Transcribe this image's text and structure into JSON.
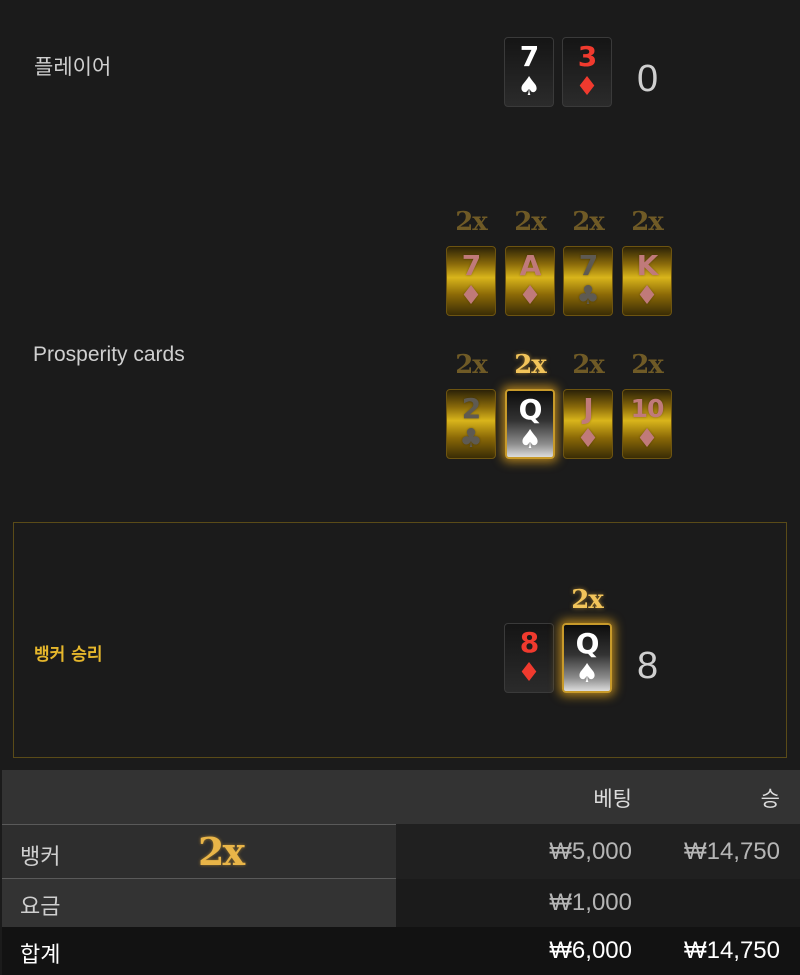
{
  "player": {
    "label": "플레이어",
    "score": "0",
    "cards": [
      {
        "rank": "7",
        "suit": "♠",
        "color": "black"
      },
      {
        "rank": "3",
        "suit": "♦",
        "color": "red"
      }
    ]
  },
  "prosperity": {
    "label": "Prosperity cards",
    "row1": [
      {
        "mult": "2x",
        "rank": "7",
        "suit": "♦"
      },
      {
        "mult": "2x",
        "rank": "A",
        "suit": "♦"
      },
      {
        "mult": "2x",
        "rank": "7",
        "suit": "♣"
      },
      {
        "mult": "2x",
        "rank": "K",
        "suit": "♦"
      }
    ],
    "row2": [
      {
        "mult": "2x",
        "rank": "2",
        "suit": "♣"
      },
      {
        "mult": "2x",
        "rank": "Q",
        "suit": "♠"
      },
      {
        "mult": "2x",
        "rank": "J",
        "suit": "♦"
      },
      {
        "mult": "2x",
        "rank": "10",
        "suit": "♦"
      }
    ]
  },
  "banker": {
    "label": "뱅커 승리",
    "score": "8",
    "mult": "2x",
    "cards": [
      {
        "rank": "8",
        "suit": "♦",
        "color": "red"
      },
      {
        "rank": "Q",
        "suit": "♠",
        "color": "black"
      }
    ]
  },
  "table": {
    "headers": {
      "bet": "베팅",
      "win": "승"
    },
    "rows": [
      {
        "label": "뱅커",
        "mult": "2x",
        "bet": "₩5,000",
        "win": "₩14,750"
      },
      {
        "label": "요금",
        "bet": "₩1,000",
        "win": ""
      },
      {
        "label": "합계",
        "bet": "₩6,000",
        "win": "₩14,750"
      }
    ]
  },
  "colors": {
    "background": "#1b1b1b",
    "gold_accent": "#e6b72c",
    "red_suit": "#f03a2e",
    "winner_border": "#5a4b18"
  }
}
